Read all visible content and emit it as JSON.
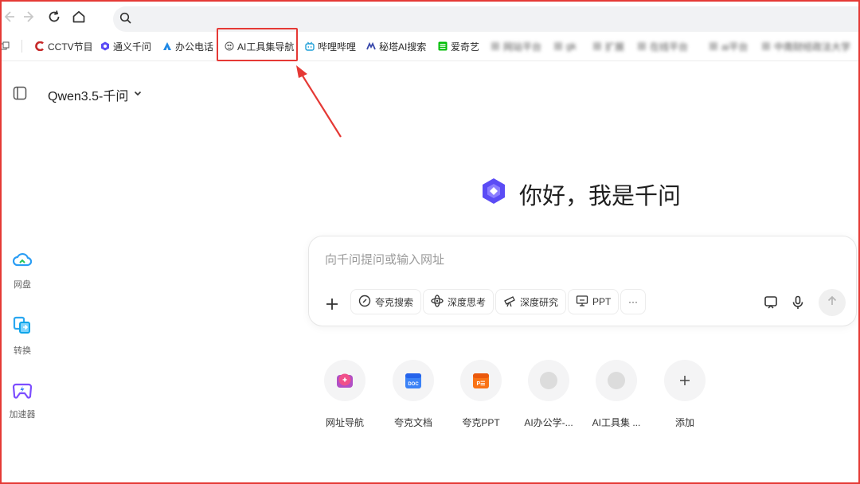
{
  "navbar": {
    "icons": [
      "back-icon",
      "forward-icon",
      "reload-icon",
      "home-icon",
      "search-icon"
    ],
    "address": {
      "placeholder": "",
      "value": ""
    }
  },
  "bookmarks": [
    {
      "label": "CCTV节目",
      "icon": "cctv-icon",
      "color": "#c62828"
    },
    {
      "label": "通义千问",
      "icon": "tongyi-icon",
      "color": "#5b4cf5"
    },
    {
      "label": "办公电话",
      "icon": "office-phone-icon",
      "color": "#1e88e5"
    },
    {
      "label": "AI工具集导航",
      "icon": "ai-tools-icon",
      "color": "#555555"
    },
    {
      "label": "哔哩哔哩",
      "icon": "bilibili-icon",
      "color": "#1e9fd8"
    },
    {
      "label": "秘塔AI搜索",
      "icon": "metaso-icon",
      "color": "#3949ab"
    },
    {
      "label": "爱奇艺",
      "icon": "iqiyi-icon",
      "color": "#00be06"
    },
    {
      "label": "网站平台",
      "icon": "blurred-icon",
      "color": "#bbbbbb"
    },
    {
      "label": "gk",
      "icon": "blurred-icon",
      "color": "#bbbbbb"
    },
    {
      "label": "扩展",
      "icon": "blurred-icon",
      "color": "#bbbbbb"
    },
    {
      "label": "在线平台",
      "icon": "blurred-icon",
      "color": "#bbbbbb"
    },
    {
      "label": "ai平台",
      "icon": "blurred-icon",
      "color": "#bbbbbb"
    },
    {
      "label": "中南财经政法大学",
      "icon": "blurred-icon",
      "color": "#bbbbbb"
    }
  ],
  "model_selector": {
    "label": "Qwen3.5-千问"
  },
  "left_apps": [
    {
      "label": "网盘",
      "icon": "cloud-drive-icon"
    },
    {
      "label": "转换",
      "icon": "convert-icon"
    },
    {
      "label": "加速器",
      "icon": "accelerator-icon"
    }
  ],
  "greeting": "你好，我是千问",
  "chat": {
    "placeholder": "向千问提问或输入网址",
    "chips": [
      {
        "label": "夸克搜索",
        "icon": "quark-search-icon"
      },
      {
        "label": "深度思考",
        "icon": "deep-think-icon"
      },
      {
        "label": "深度研究",
        "icon": "telescope-icon"
      },
      {
        "label": "PPT",
        "icon": "ppt-icon"
      },
      {
        "label": "···",
        "icon": "more-icon"
      }
    ]
  },
  "shortcuts": [
    {
      "label": "网址导航",
      "icon": "web-nav-icon"
    },
    {
      "label": "夸克文档",
      "icon": "quark-doc-icon"
    },
    {
      "label": "夸克PPT",
      "icon": "quark-ppt-icon"
    },
    {
      "label": "AI办公学-...",
      "icon": "placeholder-icon"
    },
    {
      "label": "AI工具集 ...",
      "icon": "placeholder-icon"
    },
    {
      "label": "添加",
      "icon": "add-icon"
    }
  ],
  "colors": {
    "highlight": "#e53935",
    "accent": "#5b4cf5"
  }
}
